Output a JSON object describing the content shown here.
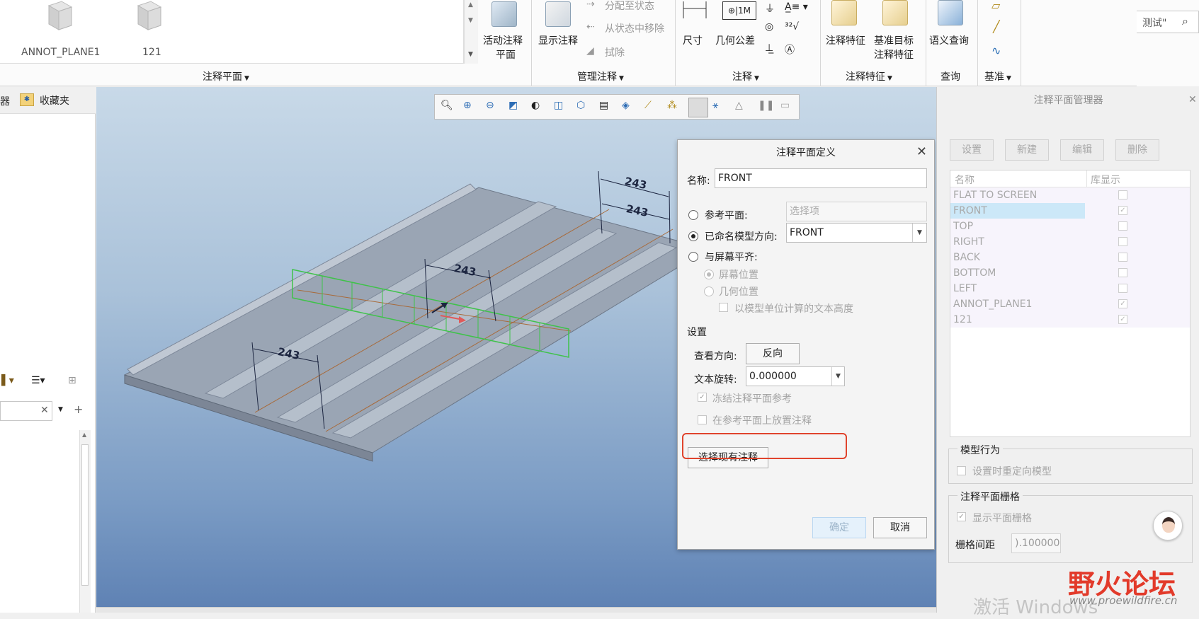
{
  "ribbon": {
    "gallery_items": [
      "ANNOT_PLANE1",
      "121"
    ],
    "groups": [
      {
        "label": "注释平面"
      },
      {
        "label": "管理注释"
      },
      {
        "label": "注释"
      },
      {
        "label": "注释特征"
      },
      {
        "label": "查询"
      },
      {
        "label": "基准"
      }
    ],
    "active_annot_plane": "活动注释\n平面",
    "active_annot_plane_l1": "活动注释",
    "active_annot_plane_l2": "平面",
    "show_annotations": "显示注释",
    "assign_to_state": "分配至状态",
    "remove_from_state": "从状态中移除",
    "erase": "拭除",
    "dimension": "尺寸",
    "geom_tolerance": "几何公差",
    "annot_feature": "注释特征",
    "datum_target_l1": "基准目标",
    "datum_target_l2": "注释特征",
    "semantic_query": "语义查询",
    "search_text": "测试\""
  },
  "left_pane": {
    "tab_label": "收藏夹",
    "truncated_tab": "器"
  },
  "dialog": {
    "title": "注释平面定义",
    "name_label": "名称:",
    "name_value": "FRONT",
    "ref_plane_label": "参考平面:",
    "ref_plane_placeholder": "选择项",
    "named_view_label": "已命名模型方向:",
    "named_view_value": "FRONT",
    "flat_to_screen_label": "与屏幕平齐:",
    "screen_position": "屏幕位置",
    "geometry_position": "几何位置",
    "text_height_model_units": "以模型单位计算的文本高度",
    "settings_heading": "设置",
    "view_direction_label": "查看方向:",
    "flip_button": "反向",
    "text_rotation_label": "文本旋转:",
    "text_rotation_value": "0.000000",
    "freeze_ref": "冻结注释平面参考",
    "place_on_ref": "在参考平面上放置注释",
    "select_existing": "选择现有注释",
    "ok": "确定",
    "cancel": "取消"
  },
  "manager": {
    "title": "注释平面管理器",
    "buttons": [
      "设置",
      "新建",
      "编辑",
      "删除"
    ],
    "columns": [
      "名称",
      "库显示"
    ],
    "rows": [
      {
        "name": "FLAT TO SCREEN",
        "checked": false
      },
      {
        "name": "FRONT",
        "checked": true,
        "selected": true
      },
      {
        "name": "TOP",
        "checked": false
      },
      {
        "name": "RIGHT",
        "checked": false
      },
      {
        "name": "BACK",
        "checked": false
      },
      {
        "name": "BOTTOM",
        "checked": false
      },
      {
        "name": "LEFT",
        "checked": false
      },
      {
        "name": "ANNOT_PLANE1",
        "checked": true
      },
      {
        "name": "121",
        "checked": true
      }
    ],
    "model_behavior_title": "模型行为",
    "reorient_on_set": "设置时重定向模型",
    "grid_title": "注释平面栅格",
    "show_grid": "显示平面栅格",
    "grid_spacing_label": "栅格间距",
    "grid_spacing_value": ").100000"
  },
  "viewport": {
    "dims": [
      "243",
      "243",
      "243",
      "243"
    ]
  },
  "watermark": {
    "activate": "激活 Windows",
    "forum": "野火论坛",
    "url": "www.proewildfire.cn"
  }
}
